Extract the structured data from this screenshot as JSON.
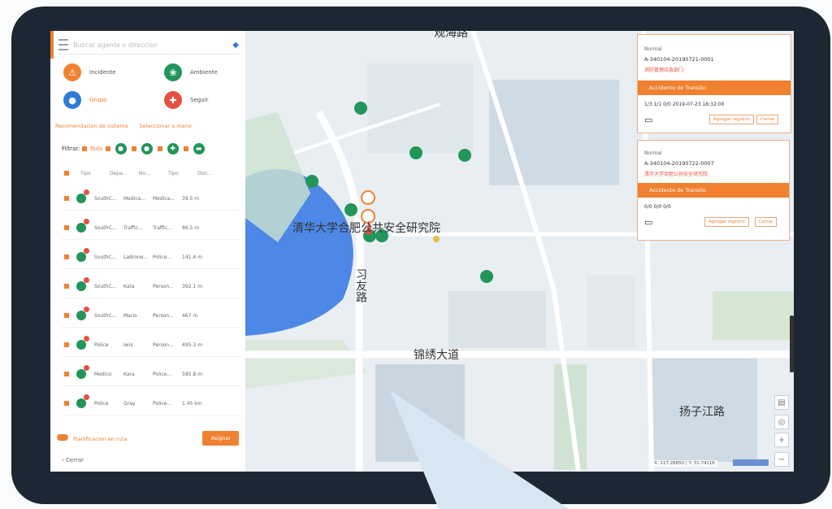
{
  "search": {
    "placeholder": "Buscar agente o direccion"
  },
  "categories": [
    {
      "label": "Incidente",
      "color": "#f08130"
    },
    {
      "label": "Ambiente",
      "color": "#21955a"
    },
    {
      "label": "Grupo",
      "color": "#2e7bd6"
    },
    {
      "label": "Seguir",
      "color": "#e65040"
    }
  ],
  "tabs": {
    "recommend": "Recomendacion de sistema",
    "select": "Seleccionar a mano"
  },
  "filter": {
    "label": "Filtrar:",
    "all": "Todo"
  },
  "table": {
    "headers": [
      "Tipo",
      "Depa...",
      "No...",
      "Tipo",
      "Dist..."
    ],
    "rows": [
      {
        "dept": "SouthC...",
        "no": "Medica...",
        "type": "Medica...",
        "dist": "39.5 m"
      },
      {
        "dept": "SouthC...",
        "no": "Traffic...",
        "type": "Traffic...",
        "dist": "86.5 m"
      },
      {
        "dept": "SouthC...",
        "no": "Ladrone...",
        "type": "Police...",
        "dist": "141.4 m"
      },
      {
        "dept": "SouthC...",
        "no": "Kata",
        "type": "Person...",
        "dist": "392.1 m"
      },
      {
        "dept": "SouthC...",
        "no": "Mario",
        "type": "Person...",
        "dist": "467 m"
      },
      {
        "dept": "Police",
        "no": "Iwis",
        "type": "Person...",
        "dist": "495.3 m"
      },
      {
        "dept": "Medico",
        "no": "Kara",
        "type": "Police...",
        "dist": "585.8 m"
      },
      {
        "dept": "Police",
        "no": "Gray",
        "type": "Police...",
        "dist": "1.45 km"
      }
    ]
  },
  "footer": {
    "toggle_label": "Planificacion en ruta",
    "assign": "Asignar",
    "collapse": "Cerrar"
  },
  "map": {
    "labels": {
      "institute": "清华大学合肥公共安全研究院",
      "road_xiyou": "习友路",
      "road_jinxiu": "锦绣大道",
      "road_yangzijiang": "扬子江路",
      "road_top": "观海路"
    },
    "coords": "X: 117.28850 | Y: 31.74116"
  },
  "cards": [
    {
      "status": "Normal",
      "id": "A-340104-20190721-0001",
      "address": "消防管理应急部门",
      "type": "Accidente de Transito",
      "stats": "1/3 1/1 0/0 2019-07-23 18:32:00",
      "btn1": "Agregar registro",
      "btn2": "Cerrar"
    },
    {
      "status": "Normal",
      "id": "A-340104-20190722-0007",
      "address": "清华大学合肥公共安全研究院",
      "type": "Accidente de Transito",
      "stats": "0/0 0/0 0/0",
      "btn1": "Agregar registro",
      "btn2": "Cerrar"
    }
  ]
}
